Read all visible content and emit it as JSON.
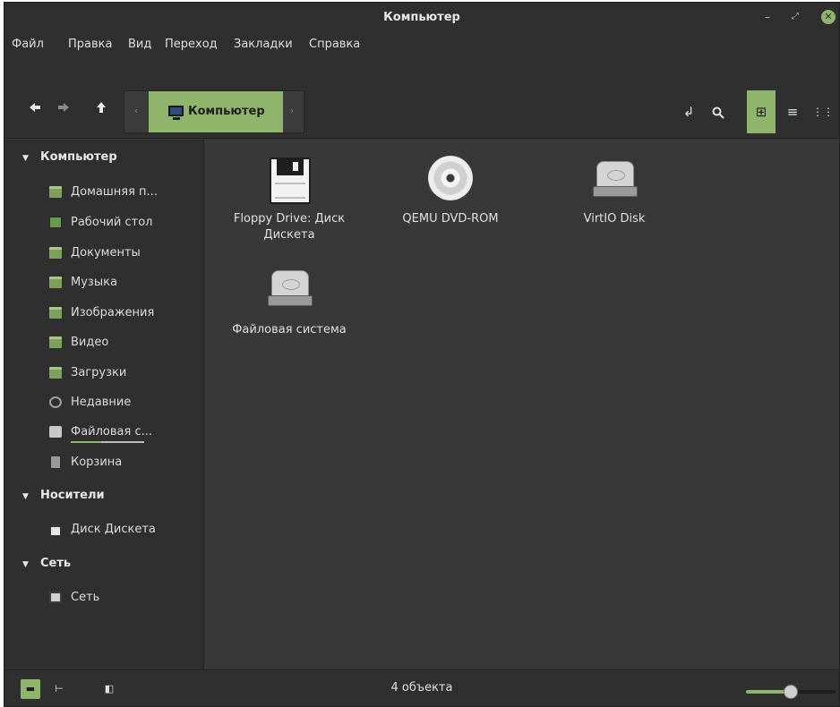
{
  "window": {
    "title": "Компьютер",
    "minimize_icon": "–",
    "maximize_icon": "⤢",
    "close_icon": "✕"
  },
  "menubar": [
    "Файл",
    "Правка",
    "Вид",
    "Переход",
    "Закладки",
    "Справка"
  ],
  "toolbar": {
    "back_icon": "◆",
    "forward_icon": "➡",
    "up_icon": "▲",
    "breadcrumb": "Компьютер",
    "crumb_left": "‹",
    "crumb_right": "›",
    "path_icon": "↲",
    "search_icon": "🔍",
    "grid_view_icon": "⊞",
    "list_view_icon": "≡",
    "compact_view_icon": "⋮⋮"
  },
  "sidebar": {
    "sections": [
      {
        "title": "Компьютер",
        "items": [
          {
            "label": "Домашняя п...",
            "icon": "home-folder"
          },
          {
            "label": "Рабочий стол",
            "icon": "desktop"
          },
          {
            "label": "Документы",
            "icon": "documents-folder"
          },
          {
            "label": "Музыка",
            "icon": "music-folder"
          },
          {
            "label": "Изображения",
            "icon": "pictures-folder"
          },
          {
            "label": "Видео",
            "icon": "videos-folder"
          },
          {
            "label": "Загрузки",
            "icon": "downloads-folder"
          },
          {
            "label": "Недавние",
            "icon": "recent"
          },
          {
            "label": "Файловая с...",
            "icon": "filesystem-drive",
            "usage_fraction": 0.41
          },
          {
            "label": "Корзина",
            "icon": "trash"
          }
        ]
      },
      {
        "title": "Носители",
        "items": [
          {
            "label": "Диск Дискета",
            "icon": "floppy"
          }
        ]
      },
      {
        "title": "Сеть",
        "items": [
          {
            "label": "Сеть",
            "icon": "network"
          }
        ]
      }
    ]
  },
  "main": {
    "items": [
      {
        "label": "Floppy Drive: Диск Дискета",
        "icon": "floppy-drive"
      },
      {
        "label": "QEMU DVD-ROM",
        "icon": "cd-rom"
      },
      {
        "label": "VirtIO Disk",
        "icon": "hard-disk"
      },
      {
        "label": "Файловая система",
        "icon": "hard-disk"
      }
    ]
  },
  "statusbar": {
    "text": "4 объекта",
    "places_icon": "▬",
    "tree_icon": "⊢",
    "sidebar_toggle_icon": "◧",
    "zoom_level": 0.5
  },
  "colors": {
    "accent": "#8fb56a",
    "background": "#383838",
    "sidebar": "#2f2f2f"
  }
}
